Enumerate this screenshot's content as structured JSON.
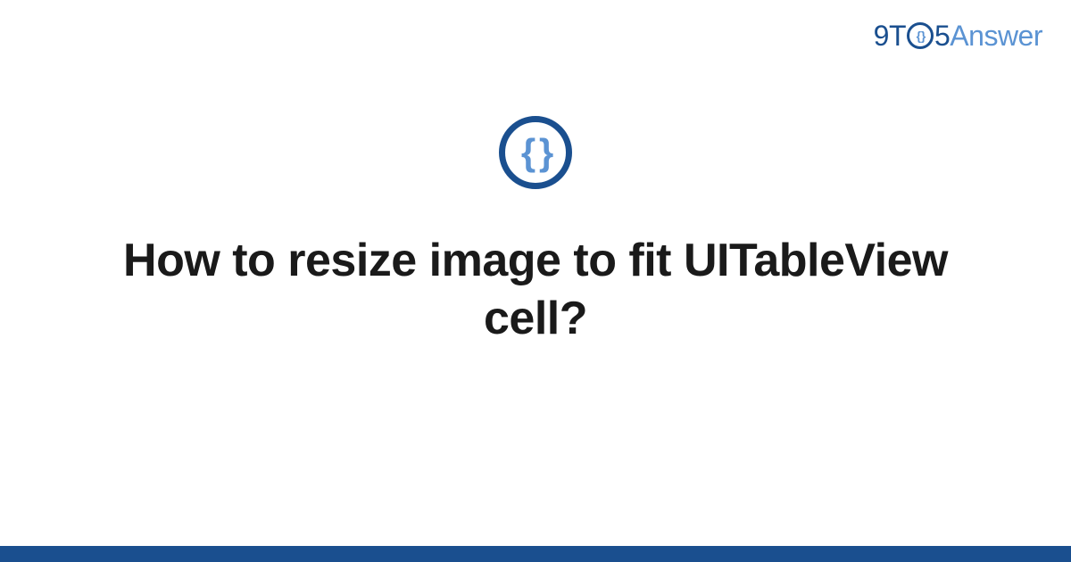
{
  "logo": {
    "part1": "9T",
    "circle_inner": "{ }",
    "part2": "5",
    "part3": "Answer"
  },
  "icon": {
    "name": "code-braces-icon",
    "glyph": "{ }"
  },
  "title": "How to resize image to fit UITableView cell?",
  "colors": {
    "primary": "#1a4f8f",
    "accent": "#5b93d3"
  }
}
